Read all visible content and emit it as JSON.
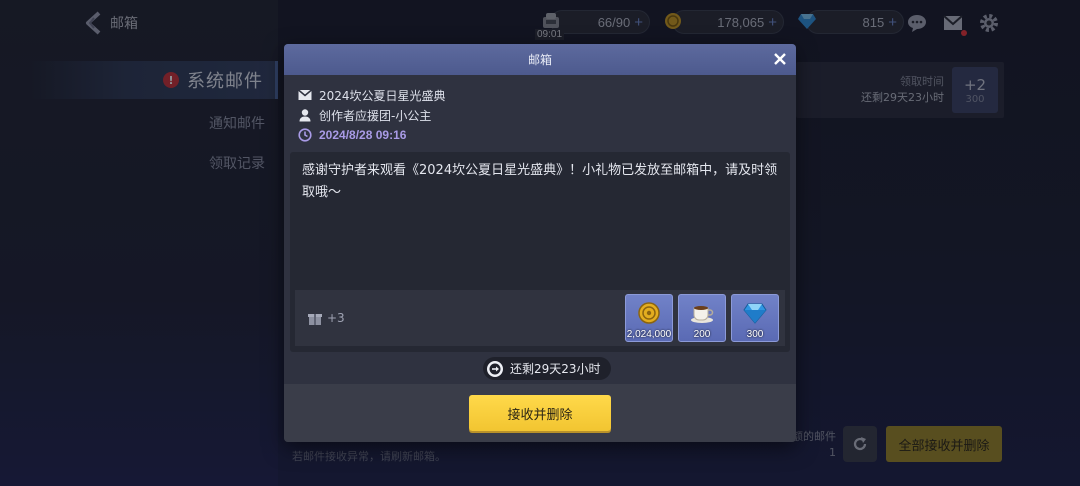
{
  "header": {
    "title": "邮箱"
  },
  "sidebar": {
    "active": {
      "alert": "!",
      "label": "系统邮件"
    },
    "items": [
      {
        "label": "通知邮件"
      },
      {
        "label": "领取记录"
      }
    ]
  },
  "resources": {
    "stamina": {
      "value": "66/90",
      "time": "09:01"
    },
    "coins": {
      "value": "178,065"
    },
    "gems": {
      "value": "815"
    }
  },
  "background_card": {
    "claim_label": "领取时间",
    "remaining": "还剩29天23小时",
    "plus": "+2",
    "sub": "300"
  },
  "bottom": {
    "hint": "若邮件接收异常，请刷新邮箱。",
    "count_label": "额的邮件",
    "count": "1",
    "collect_all": "全部接收并删除"
  },
  "modal": {
    "title": "邮箱",
    "subject": "2024坎公夏日星光盛典",
    "sender": "创作者应援团-小公主",
    "date": "2024/8/28 09:16",
    "body": "感谢守护者来观看《2024坎公夏日星光盛典》！小礼物已发放至邮箱中，请及时领取哦～",
    "gift_extra": "+3",
    "items": [
      {
        "icon": "gold-coin-icon",
        "qty": "2,024,000"
      },
      {
        "icon": "coffee-cup-icon",
        "qty": "200"
      },
      {
        "icon": "diamond-gem-icon",
        "qty": "300"
      }
    ],
    "expire": "还剩29天23小时",
    "primary_button": "接收并删除"
  }
}
